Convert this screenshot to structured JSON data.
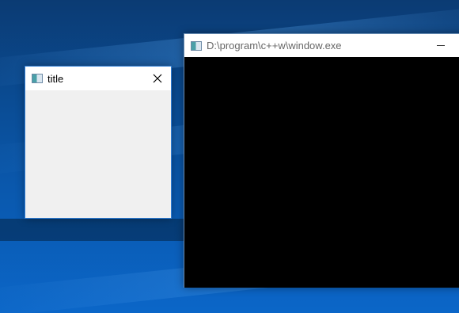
{
  "small_window": {
    "title": "title",
    "close_icon": "close-icon",
    "app_icon": "window-app-icon"
  },
  "console_window": {
    "title": "D:\\program\\c++w\\window.exe",
    "minimize_icon": "minimize-icon",
    "app_icon": "console-app-icon"
  },
  "colors": {
    "console_background": "#000000",
    "client_background": "#f0f0f0",
    "titlebar_background": "#ffffff",
    "desktop_accent": "#0a58ad"
  }
}
